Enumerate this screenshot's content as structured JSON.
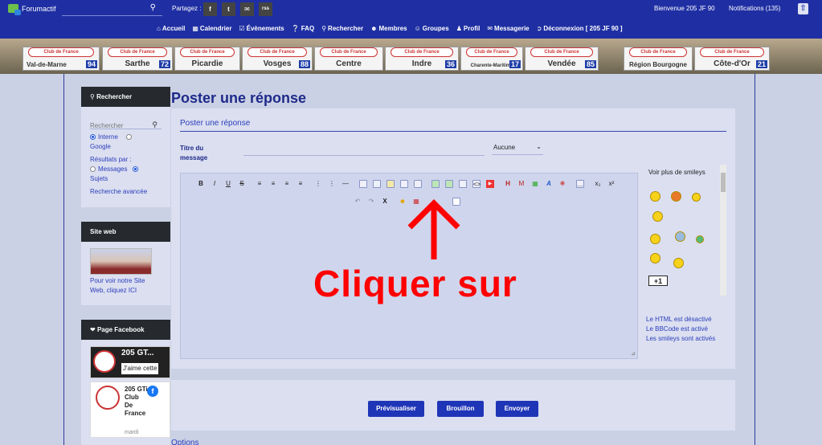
{
  "topbar": {
    "logo": "Forumactif",
    "search_placeholder": "",
    "share_label": "Partagez :",
    "share_buttons": [
      "f",
      "t",
      "✉",
      "rss"
    ],
    "welcome": "Bienvenue 205 JF 90",
    "notifications": "Notifications (135)"
  },
  "nav": {
    "items": [
      "Accueil",
      "Calendrier",
      "Évènements",
      "FAQ",
      "Rechercher",
      "Membres",
      "Groupes",
      "Profil",
      "Messagerie",
      "Déconnexion [ 205 JF 90 ]"
    ]
  },
  "banner": {
    "plaque_header": "Club de France",
    "plaques": [
      {
        "name": "Val-de-Marne",
        "num": "94"
      },
      {
        "name": "Sarthe",
        "num": "72"
      },
      {
        "name": "Picardie",
        "num": ""
      },
      {
        "name": "Vosges",
        "num": "88"
      },
      {
        "name": "Centre",
        "num": ""
      },
      {
        "name": "Indre",
        "num": "36"
      },
      {
        "name": "Charente-Maritime",
        "num": "17"
      },
      {
        "name": "Vendée",
        "num": "85"
      },
      {
        "name": "Région Bourgogne",
        "num": ""
      },
      {
        "name": "Côte-d'Or",
        "num": "21"
      }
    ]
  },
  "sidebar": {
    "search": {
      "title": "Rechercher",
      "placeholder": "Rechercher",
      "option_internal": "Interne",
      "option_google": "Google",
      "results_label": "Résultats par :",
      "option_messages": "Messages",
      "option_subjects": "Sujets",
      "advanced": "Recherche avancée"
    },
    "website": {
      "title": "Site web",
      "text": "Pour voir notre Site Web, cliquez ICI"
    },
    "facebook": {
      "title": "Page Facebook",
      "page_name": "205 GT...",
      "like": "J'aime cette",
      "card_name": "205 GTi Club De France",
      "card_date": "mardi"
    }
  },
  "main": {
    "page_title": "Poster une réponse",
    "panel_title": "Poster une réponse",
    "message_title_label": "Titre du message",
    "message_title_value": "",
    "select_value": "Aucune",
    "smileys_dropdown": "Voir plus de smileys",
    "info": [
      "Le HTML est désactivé",
      "Le BBCode est activé",
      "Les smileys sont activés"
    ],
    "annotation": "Cliquer sur",
    "buttons": {
      "preview": "Prévisualiser",
      "draft": "Brouillon",
      "send": "Envoyer"
    },
    "options": "Options"
  },
  "colors": {
    "topbar": "#1f2fa3",
    "accent": "#1f35b8",
    "annotation": "#ff0000",
    "panel": "#dbdff0",
    "background": "#cbd1e5"
  }
}
